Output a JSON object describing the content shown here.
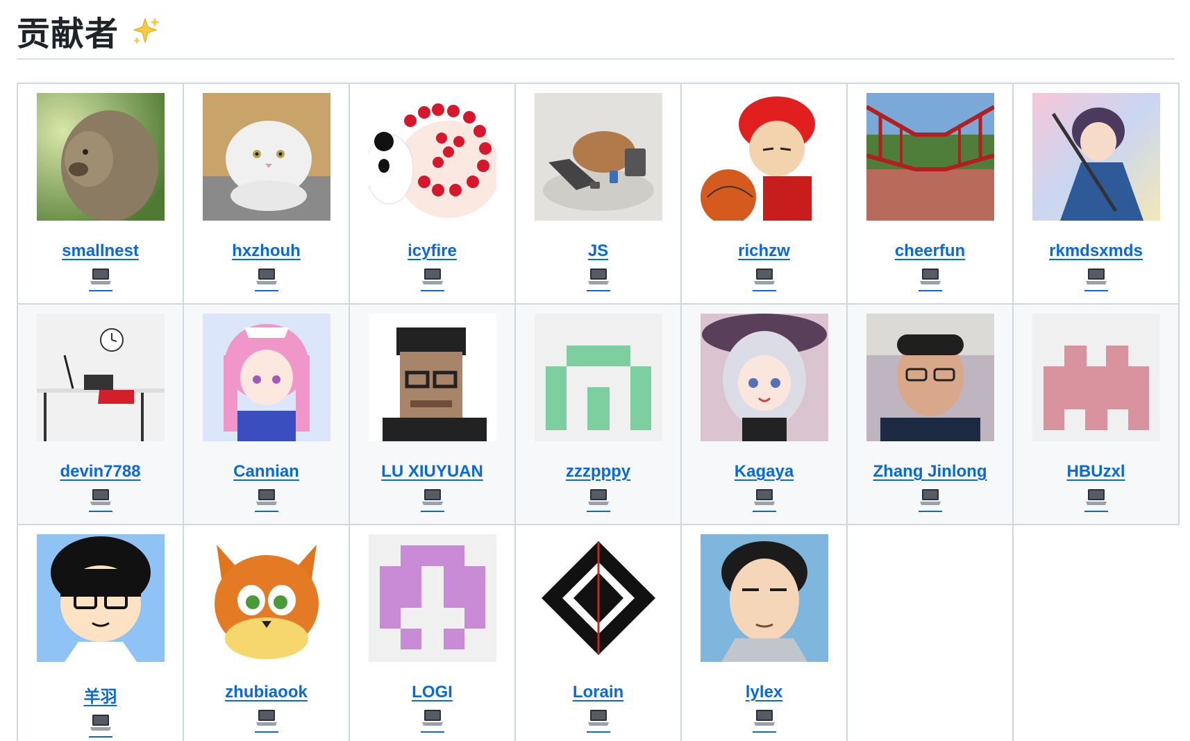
{
  "heading": {
    "title": "贡献者",
    "sparkle_icon": "sparkles-icon"
  },
  "contribution_icon": "laptop-icon",
  "colors": {
    "link": "#0969da",
    "border": "#d0d7de",
    "alt_row_bg": "#f6f8fa"
  },
  "rows": [
    [
      {
        "login": "smallnest",
        "avatar": "monkey-photo"
      },
      {
        "login": "hxzhouh",
        "avatar": "white-cat-photo"
      },
      {
        "login": "icyfire",
        "avatar": "strawberry-cake-panda"
      },
      {
        "login": "JS",
        "avatar": "capybara-laptop-illustration"
      },
      {
        "login": "richzw",
        "avatar": "red-hair-basketball-anime"
      },
      {
        "login": "cheerfun",
        "avatar": "red-bridge-photo"
      },
      {
        "login": "rkmdsxmds",
        "avatar": "anime-girl-sword"
      }
    ],
    [
      {
        "login": "devin7788",
        "avatar": "desk-chair-photo"
      },
      {
        "login": "Cannian",
        "avatar": "pink-hair-maid-anime"
      },
      {
        "login": "LU XIUYUAN",
        "avatar": "pixel-portrait-glasses"
      },
      {
        "login": "zzzpppy",
        "avatar": "green-identicon"
      },
      {
        "login": "Kagaya",
        "avatar": "silver-hair-witch-anime"
      },
      {
        "login": "Zhang Jinlong",
        "avatar": "man-glasses-photo"
      },
      {
        "login": "HBUzxl",
        "avatar": "pink-identicon"
      }
    ],
    [
      {
        "login": "羊羽",
        "avatar": "cartoon-boy-glasses"
      },
      {
        "login": "zhubiaook",
        "avatar": "orange-cat-cartoon"
      },
      {
        "login": "LOGI",
        "avatar": "purple-identicon"
      },
      {
        "login": "Lorain",
        "avatar": "black-geometric-logo"
      },
      {
        "login": "lylex",
        "avatar": "cartoon-man-portrait"
      }
    ]
  ]
}
